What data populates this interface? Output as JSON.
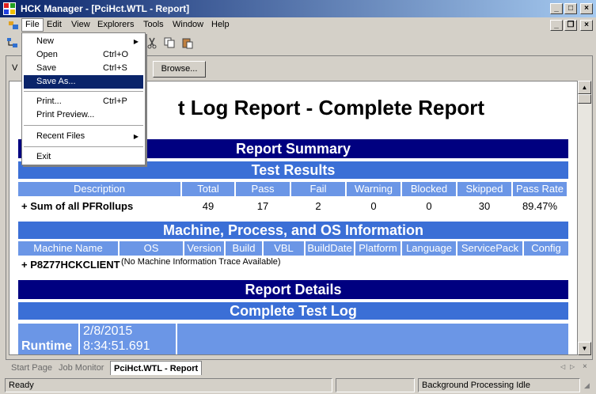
{
  "window": {
    "title": "HCK Manager - [PciHct.WTL - Report]"
  },
  "menubar": [
    "File",
    "Edit",
    "View",
    "Explorers",
    "Tools",
    "Window",
    "Help"
  ],
  "file_menu": {
    "items": [
      {
        "label": "New",
        "shortcut": "",
        "submenu": true
      },
      {
        "label": "Open",
        "shortcut": "Ctrl+O"
      },
      {
        "label": "Save",
        "shortcut": "Ctrl+S"
      },
      {
        "label": "Save As...",
        "shortcut": "",
        "highlighted": true
      },
      {
        "label": "Print...",
        "shortcut": "Ctrl+P"
      },
      {
        "label": "Print Preview...",
        "shortcut": ""
      },
      {
        "label": "Recent Files",
        "shortcut": "",
        "submenu": true
      },
      {
        "label": "Exit",
        "shortcut": ""
      }
    ]
  },
  "toolbar": {
    "view_label": "V",
    "browse_label": "Browse..."
  },
  "report": {
    "title": "t Log Report - Complete Report",
    "summary_heading": "Report Summary",
    "test_results_heading": "Test Results",
    "results_columns": [
      "Description",
      "Total",
      "Pass",
      "Fail",
      "Warning",
      "Blocked",
      "Skipped",
      "Pass Rate"
    ],
    "results_row": [
      "+ Sum of all PFRollups",
      "49",
      "17",
      "2",
      "0",
      "0",
      "30",
      "89.47%"
    ],
    "machine_heading": "Machine, Process, and OS Information",
    "machine_columns": [
      "Machine Name",
      "OS",
      "Version",
      "Build",
      "VBL",
      "BuildDate",
      "Platform",
      "Language",
      "ServicePack",
      "Config"
    ],
    "machine_name": "+ P8Z77HCKCLIENT",
    "machine_note": "(No Machine Information Trace Available)",
    "details_heading": "Report Details",
    "log_heading": "Complete Test Log",
    "runtime_label": "Runtime",
    "runtime_date": "2/8/2015",
    "runtime_time": "8:34:51.691"
  },
  "tabs": [
    "Start Page",
    "Job Monitor",
    "PciHct.WTL - Report"
  ],
  "status": {
    "left": "Ready",
    "right": "Background Processing Idle"
  },
  "colors": {
    "band_dark": "#000080",
    "band_mid": "#3b6fd6",
    "header_cell": "#6b96e6",
    "title_bar": "#0a246a"
  }
}
